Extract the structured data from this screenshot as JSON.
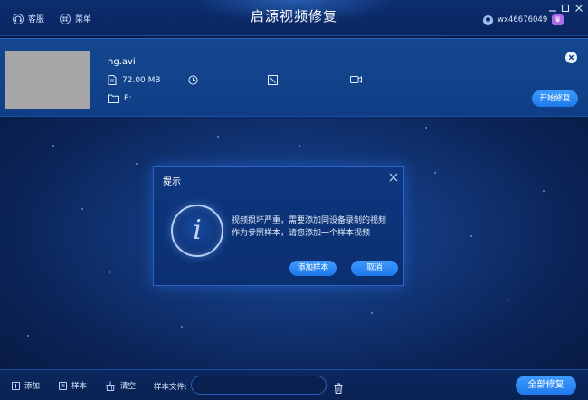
{
  "titlebar": {
    "title": "启源视频修复",
    "support_label": "客服",
    "menu_label": "菜单",
    "username": "wx46676049",
    "vip_badge": "♛"
  },
  "file": {
    "name": "ng.avi",
    "size": "72.00 MB",
    "path": "E:",
    "repair_label": "开始修复"
  },
  "dialog": {
    "title": "提示",
    "icon_letter": "i",
    "message": "视频损坏严重，需要添加同设备录制的视频作为参照样本，请您添加一个样本视频",
    "add_sample_label": "添加样本",
    "cancel_label": "取消"
  },
  "bottom": {
    "add_label": "添加",
    "sample_label": "样本",
    "clear_label": "清空",
    "sample_file_label": "样本文件:",
    "sample_file_value": "",
    "repair_all_label": "全部修复"
  },
  "colors": {
    "accent": "#2a87f5",
    "background": "#12377a",
    "panel": "#14478f",
    "vip": "#b26be6"
  }
}
